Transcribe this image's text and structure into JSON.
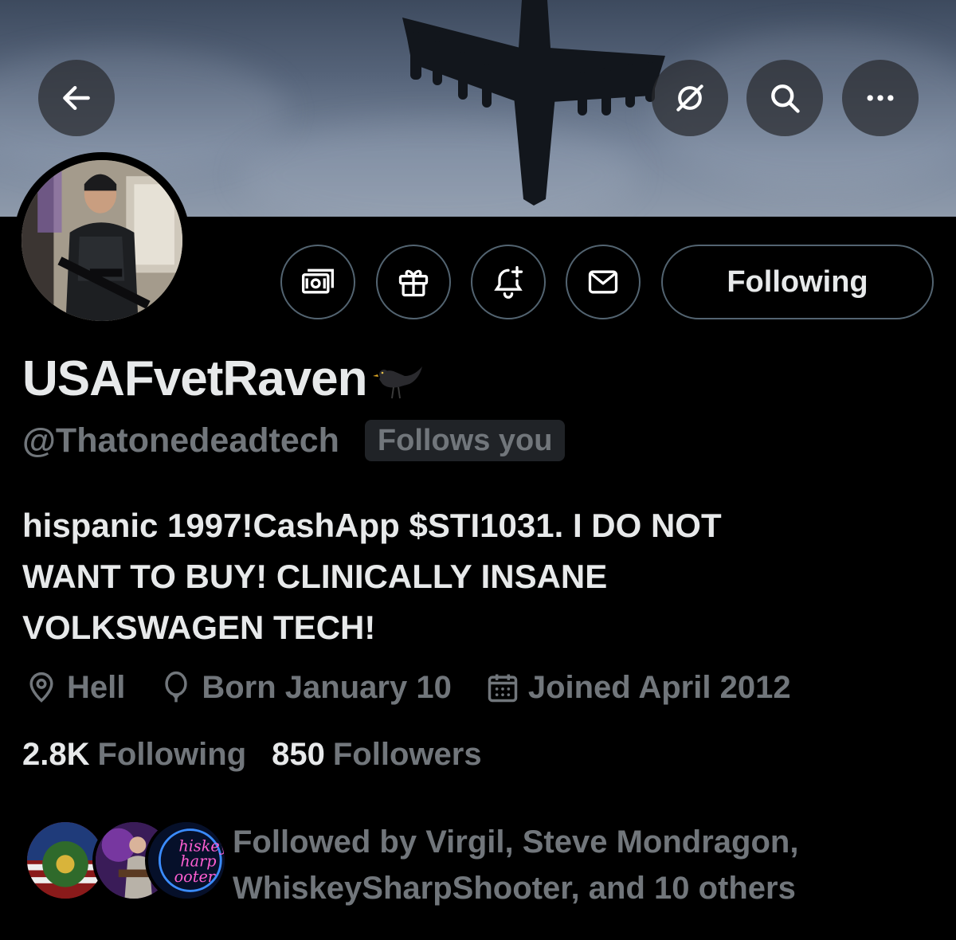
{
  "header": {
    "back_icon": "arrow-left-icon",
    "grok_icon": "grok-icon",
    "search_icon": "search-icon",
    "more_icon": "more-horizontal-icon"
  },
  "profile": {
    "display_name": "USAFvetRaven",
    "name_emoji": "blackbird-emoji",
    "handle": "@Thatonedeadtech",
    "follows_you_badge": "Follows you",
    "bio_lines": [
      "hispanic 1997!CashApp $STI1031. I DO NOT",
      "WANT TO BUY! CLINICALLY INSANE",
      "VOLKSWAGEN TECH!"
    ],
    "location": "Hell",
    "birthday": "Born January 10",
    "joined": "Joined April 2012",
    "following_count": "2.8K",
    "following_label": "Following",
    "followers_count": "850",
    "followers_label": "Followers",
    "followed_by_lines": [
      "Followed by Virgil, Steve Mondragon,",
      "WhiskeySharpShooter, and 10 others"
    ],
    "mini_avatar_3_text": [
      "hiskey",
      "harp",
      "ooter"
    ]
  },
  "actions": {
    "tip_icon": "money-icon",
    "gift_icon": "gift-icon",
    "notify_icon": "bell-plus-icon",
    "message_icon": "envelope-icon",
    "follow_button_label": "Following"
  },
  "colors": {
    "background": "#000000",
    "primary_text": "#e7e9ea",
    "secondary_text": "#71767b",
    "border": "#536471"
  }
}
